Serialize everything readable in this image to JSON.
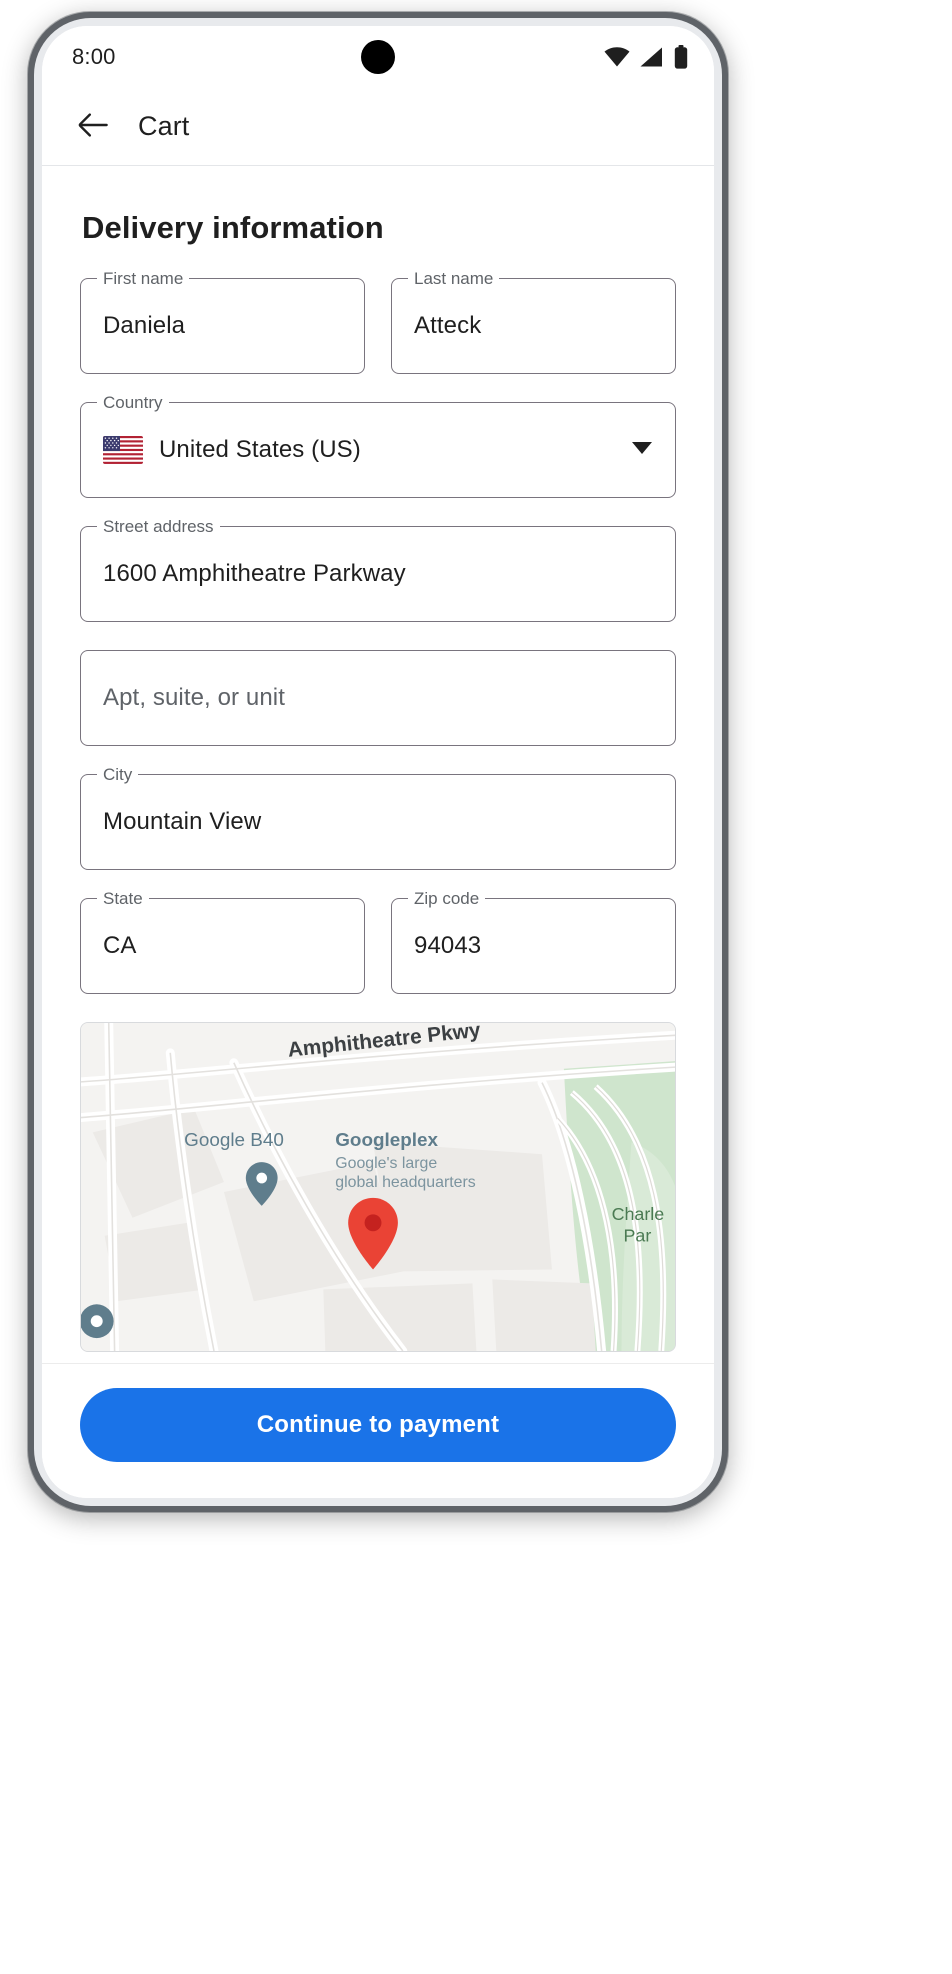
{
  "status_bar": {
    "time": "8:00",
    "icons": [
      "wifi-icon",
      "cellular-signal-icon",
      "battery-icon"
    ]
  },
  "app_bar": {
    "back_icon": "arrow-back-icon",
    "title": "Cart"
  },
  "main": {
    "section_title": "Delivery information",
    "fields": [
      {
        "name": "first-name",
        "label": "First name",
        "value": "Daniela",
        "placeholder": ""
      },
      {
        "name": "last-name",
        "label": "Last name",
        "value": "Atteck",
        "placeholder": ""
      },
      {
        "name": "country",
        "label": "Country",
        "value": "United States (US)",
        "placeholder": ""
      },
      {
        "name": "street-address",
        "label": "Street address",
        "value": "1600 Amphitheatre Parkway",
        "placeholder": ""
      },
      {
        "name": "apt-suite-unit",
        "label": "",
        "value": "",
        "placeholder": "Apt, suite, or unit"
      },
      {
        "name": "city",
        "label": "City",
        "value": "Mountain View",
        "placeholder": ""
      },
      {
        "name": "state",
        "label": "State",
        "value": "CA",
        "placeholder": ""
      },
      {
        "name": "zip-code",
        "label": "Zip code",
        "value": "94043",
        "placeholder": ""
      }
    ],
    "map": {
      "street_label": "Amphitheatre Pkwy",
      "poi_b40": "Google B40",
      "poi_googleplex_title": "Googleplex",
      "poi_googleplex_line1": "Google's large",
      "poi_googleplex_line2": "global headquarters",
      "poi_park": "Charle",
      "poi_park_line2": "Par",
      "marker_color": "#ea4335",
      "poi_pin_color": "#5f7d8c"
    }
  },
  "bottom_bar": {
    "cta_label": "Continue to payment",
    "cta_color": "#1a73e8"
  }
}
